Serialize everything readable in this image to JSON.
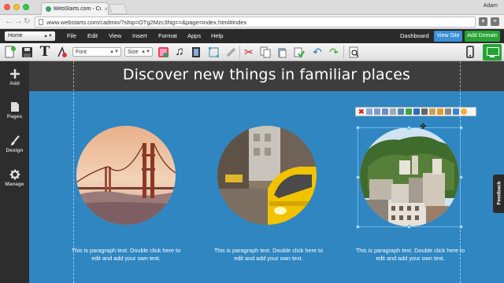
{
  "browser": {
    "tab_title": "WebStarts.com - Custom Web",
    "tab_close": "×",
    "profile_name": "Adam",
    "url": "www.webstarts.com/cadmin/?ship=OTg2Mzc3Ng==&page=index.html#index"
  },
  "menubar": {
    "page_select": "Home",
    "items": [
      "File",
      "Edit",
      "View",
      "Insert",
      "Format",
      "Apps",
      "Help"
    ],
    "dashboard": "Dashboard",
    "view_site": "View Site",
    "add_domain": "Add Domain"
  },
  "toolbar": {
    "font_select": "Font",
    "size_select": "Size"
  },
  "sidebar": {
    "items": [
      {
        "label": "Add"
      },
      {
        "label": "Pages"
      },
      {
        "label": "Design"
      },
      {
        "label": "Manage"
      }
    ]
  },
  "canvas": {
    "headline": "Discover new things in familiar places",
    "columns": [
      {
        "image": "golden-gate-bridge",
        "text": "This is paragraph text. Double click here to edit and add your own text."
      },
      {
        "image": "yellow-taxi-street",
        "text": "This is paragraph text. Double click here to edit and add your own text."
      },
      {
        "image": "hillside-town",
        "text": "This is paragraph text. Double click here to edit and add your own text."
      }
    ]
  },
  "feedback_tab": "Feedback",
  "colors": {
    "canvas_blue": "#2f86c1",
    "view_site_blue": "#3a8fd6",
    "add_domain_green": "#27a336"
  }
}
